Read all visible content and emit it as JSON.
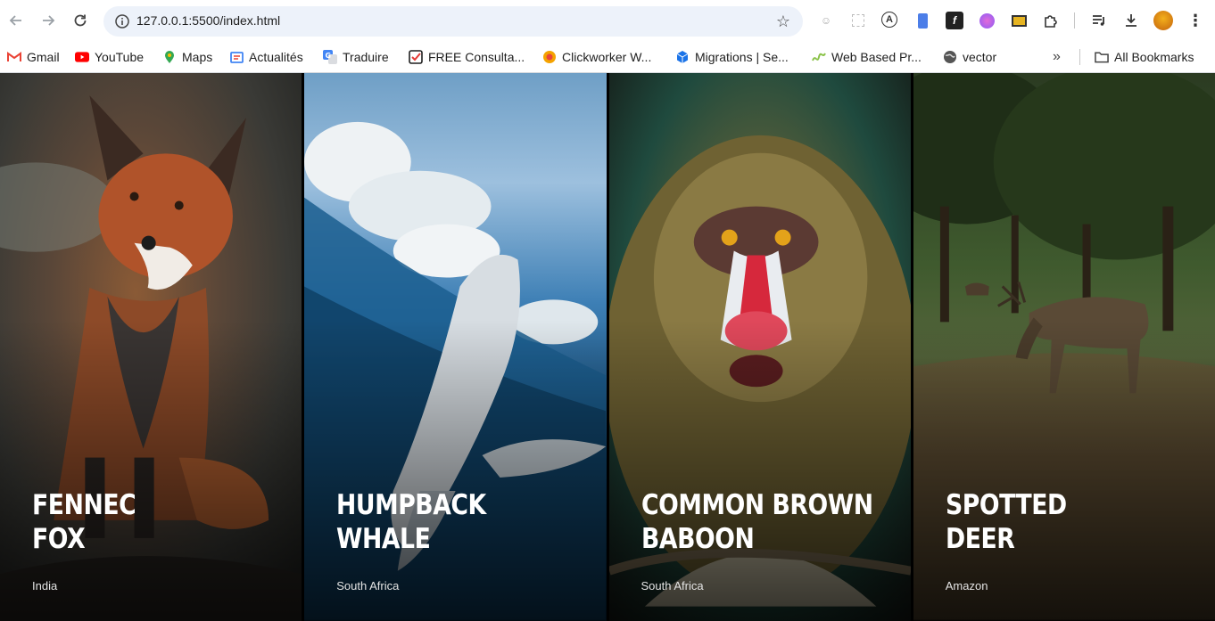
{
  "browser": {
    "url": "127.0.0.1:5500/index.html",
    "bookmarks": [
      {
        "label": "Gmail",
        "icon": "gmail-icon",
        "color": "#ea4335"
      },
      {
        "label": "YouTube",
        "icon": "youtube-icon",
        "color": "#ff0000"
      },
      {
        "label": "Maps",
        "icon": "maps-icon",
        "color": "#34a853"
      },
      {
        "label": "Actualités",
        "icon": "news-icon",
        "color": "#4285f4"
      },
      {
        "label": "Traduire",
        "icon": "translate-icon",
        "color": "#4285f4"
      },
      {
        "label": "FREE Consulta...",
        "icon": "checklist-icon",
        "color": "#2a7d3f"
      },
      {
        "label": "Clickworker W...",
        "icon": "clickworker-icon",
        "color": "#f4a300"
      },
      {
        "label": "Migrations | Se...",
        "icon": "cube-icon",
        "color": "#1a73e8"
      },
      {
        "label": "Web Based Pr...",
        "icon": "wave-icon",
        "color": "#8bc34a"
      },
      {
        "label": "vector",
        "icon": "globe-icon",
        "color": "#444444"
      }
    ],
    "all_bookmarks_label": "All Bookmarks"
  },
  "cards": [
    {
      "title_line1": "FENNEC",
      "title_line2": "FOX",
      "location": "India"
    },
    {
      "title_line1": "HUMPBACK",
      "title_line2": "WHALE",
      "location": "South Africa"
    },
    {
      "title_line1": "COMMON BROWN",
      "title_line2": "BABOON",
      "location": "South Africa"
    },
    {
      "title_line1": "SPOTTED",
      "title_line2": "DEER",
      "location": "Amazon"
    }
  ]
}
